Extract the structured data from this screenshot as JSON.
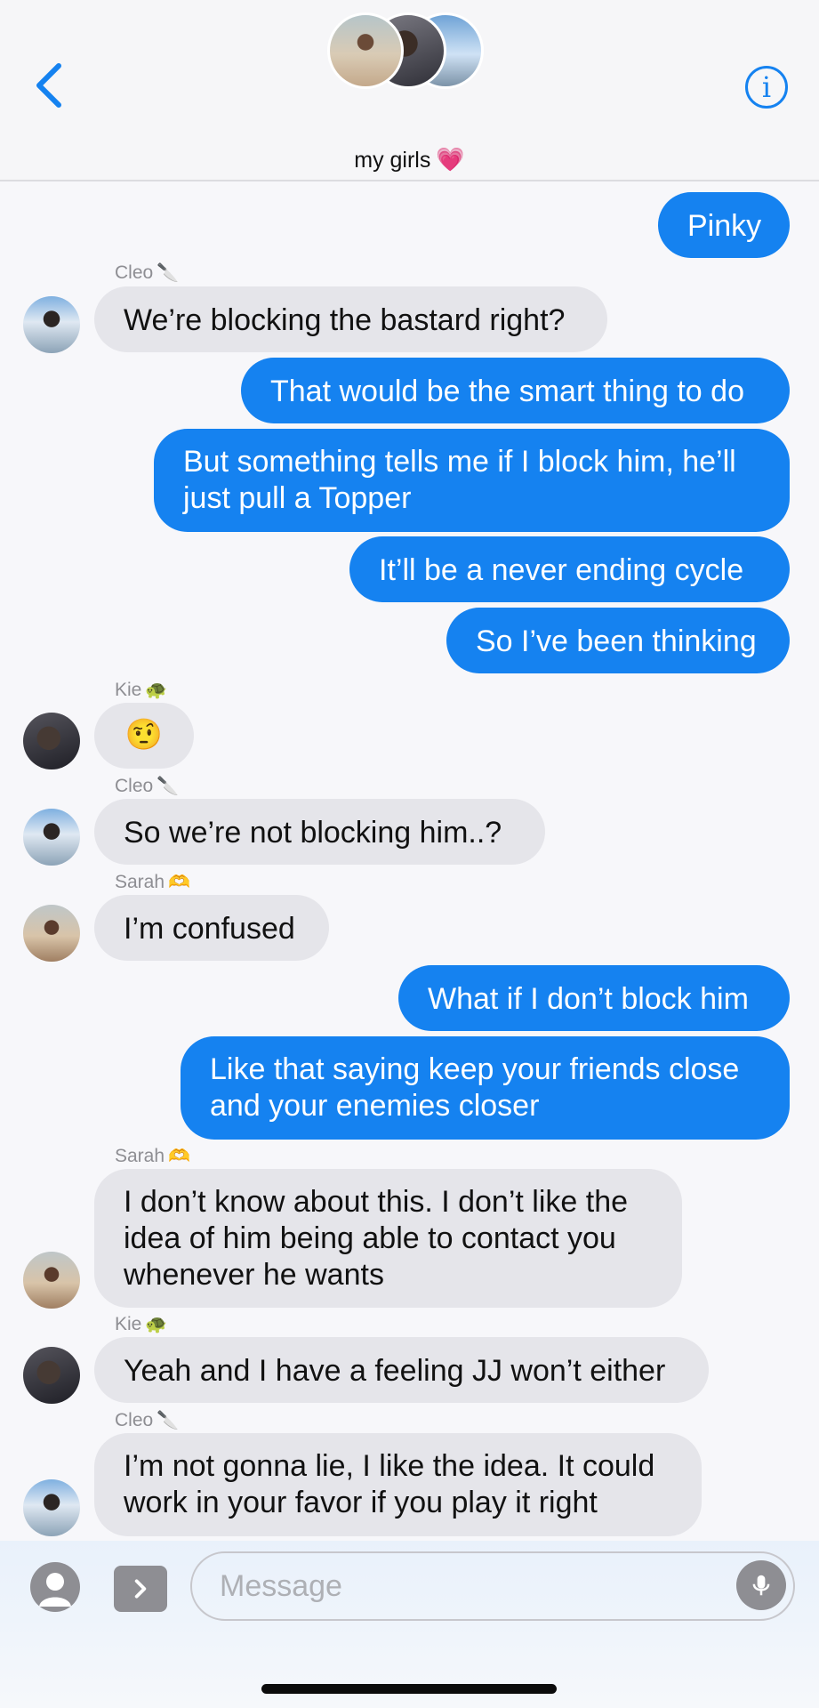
{
  "header": {
    "title": "my girls",
    "title_emoji": "💗",
    "info_label": "i"
  },
  "messages": [
    {
      "id": "m1",
      "side": "out",
      "text": "Pinky"
    },
    {
      "id": "m2",
      "side": "in",
      "sender": "Cleo",
      "sender_emoji": "🔪",
      "text": "We’re blocking the bastard right?"
    },
    {
      "id": "m3",
      "side": "out",
      "text": "That would be the smart thing to do"
    },
    {
      "id": "m4",
      "side": "out",
      "lines": [
        "But something tells me if I block him, he’ll",
        "just pull a Topper"
      ]
    },
    {
      "id": "m5",
      "side": "out",
      "text": "It’ll be a never ending cycle"
    },
    {
      "id": "m6",
      "side": "out",
      "text": "So I’ve been thinking"
    },
    {
      "id": "m7",
      "side": "in",
      "sender": "Kie",
      "sender_emoji": "🐢",
      "text": "🤨"
    },
    {
      "id": "m8",
      "side": "in",
      "sender": "Cleo",
      "sender_emoji": "🔪",
      "text": "So we’re not blocking him..?"
    },
    {
      "id": "m9",
      "side": "in",
      "sender": "Sarah",
      "sender_emoji": "🫶",
      "text": "I’m confused"
    },
    {
      "id": "m10",
      "side": "out",
      "text": "What if I don’t block him"
    },
    {
      "id": "m11",
      "side": "out",
      "lines": [
        "Like that saying keep your friends close",
        "and your enemies closer"
      ]
    },
    {
      "id": "m12",
      "side": "in",
      "sender": "Sarah",
      "sender_emoji": "🫶",
      "lines": [
        "I don’t know about this. I don’t like the",
        "idea of him being able to contact you",
        "whenever he wants"
      ]
    },
    {
      "id": "m13",
      "side": "in",
      "sender": "Kie",
      "sender_emoji": "🐢",
      "text": "Yeah and I have a feeling JJ won’t either"
    },
    {
      "id": "m14",
      "side": "in",
      "sender": "Cleo",
      "sender_emoji": "🔪",
      "lines": [
        "I’m not gonna lie, I like the idea. It could",
        "work in your favor if you play it right"
      ]
    }
  ],
  "input": {
    "placeholder": "Message",
    "value": ""
  },
  "colors": {
    "outgoing_bubble": "#1582f0",
    "incoming_bubble": "#e5e5ea",
    "accent": "#1582f0"
  },
  "icons": [
    "chevron-left-icon",
    "info-icon",
    "camera-icon",
    "app-store-icon",
    "microphone-icon"
  ]
}
